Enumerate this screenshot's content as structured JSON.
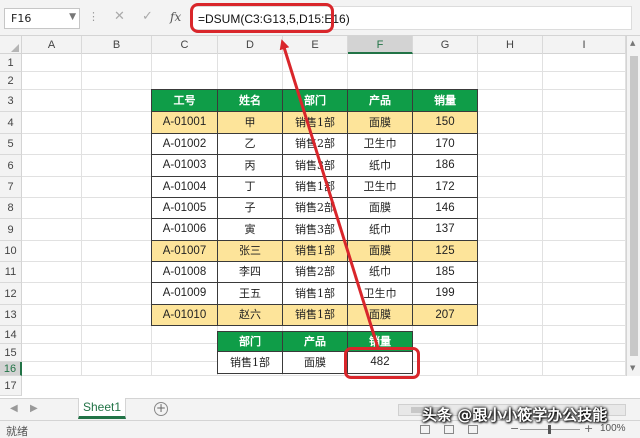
{
  "app": {
    "name_box": "F16",
    "formula": "=DSUM(C3:G13,5,D15:E16)"
  },
  "columns": [
    "A",
    "B",
    "C",
    "D",
    "E",
    "F",
    "G",
    "H",
    "I"
  ],
  "rows": [
    "1",
    "2",
    "3",
    "4",
    "5",
    "6",
    "7",
    "8",
    "9",
    "10",
    "11",
    "12",
    "13",
    "14",
    "15",
    "16",
    "17"
  ],
  "active_cell": {
    "column": "F",
    "row": "16"
  },
  "data_table": {
    "headers": [
      "工号",
      "姓名",
      "部门",
      "产品",
      "销量"
    ],
    "rows": [
      {
        "id": "A-01001",
        "name": "甲",
        "dept": "销售1部",
        "product": "面膜",
        "sales": "150",
        "highlight": true
      },
      {
        "id": "A-01002",
        "name": "乙",
        "dept": "销售2部",
        "product": "卫生巾",
        "sales": "170",
        "highlight": false
      },
      {
        "id": "A-01003",
        "name": "丙",
        "dept": "销售3部",
        "product": "纸巾",
        "sales": "186",
        "highlight": false
      },
      {
        "id": "A-01004",
        "name": "丁",
        "dept": "销售1部",
        "product": "卫生巾",
        "sales": "172",
        "highlight": false
      },
      {
        "id": "A-01005",
        "name": "子",
        "dept": "销售2部",
        "product": "面膜",
        "sales": "146",
        "highlight": false
      },
      {
        "id": "A-01006",
        "name": "寅",
        "dept": "销售3部",
        "product": "纸巾",
        "sales": "137",
        "highlight": false
      },
      {
        "id": "A-01007",
        "name": "张三",
        "dept": "销售1部",
        "product": "面膜",
        "sales": "125",
        "highlight": true
      },
      {
        "id": "A-01008",
        "name": "李四",
        "dept": "销售2部",
        "product": "纸巾",
        "sales": "185",
        "highlight": false
      },
      {
        "id": "A-01009",
        "name": "王五",
        "dept": "销售1部",
        "product": "卫生巾",
        "sales": "199",
        "highlight": false
      },
      {
        "id": "A-01010",
        "name": "赵六",
        "dept": "销售1部",
        "product": "面膜",
        "sales": "207",
        "highlight": true
      }
    ]
  },
  "criteria_table": {
    "headers": [
      "部门",
      "产品",
      "销量"
    ],
    "values": [
      "销售1部",
      "面膜",
      "482"
    ]
  },
  "sheet_tabs": [
    "Sheet1"
  ],
  "status": {
    "ready": "就绪",
    "zoom": "100%"
  },
  "watermark": "头条 @跟小小筱学办公技能",
  "colors": {
    "header_green": "#0f9d48",
    "highlight_yellow": "#fde49a",
    "annotation_red": "#d9262b",
    "excel_green": "#217346"
  },
  "icons": [
    "cancel-icon",
    "enter-icon",
    "fx-icon",
    "add-sheet-icon",
    "normal-view-icon",
    "page-layout-icon",
    "page-break-icon"
  ]
}
